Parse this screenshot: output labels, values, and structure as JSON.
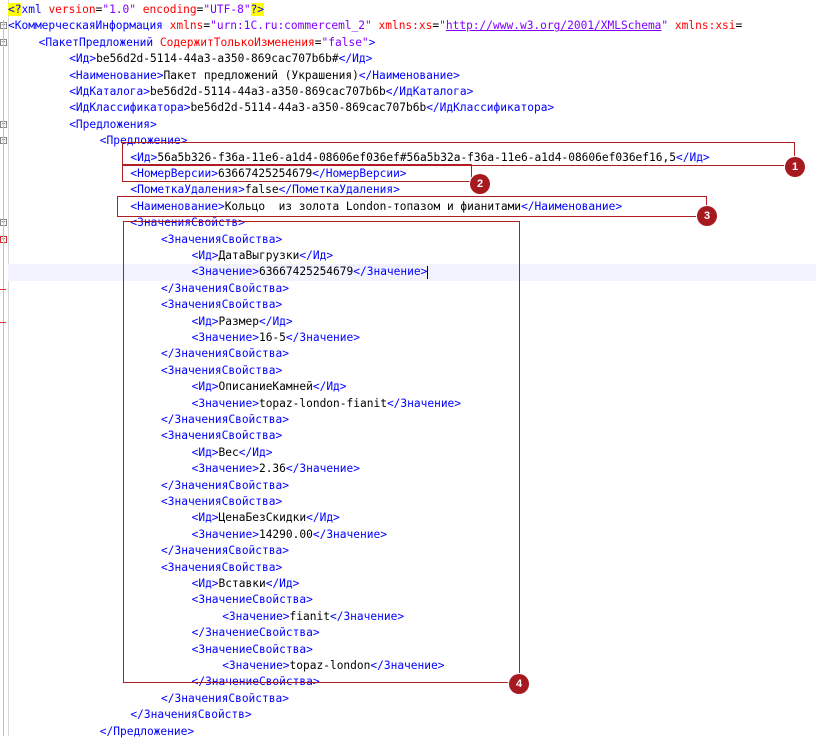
{
  "editor": {
    "lines": [
      {
        "indent": 0,
        "parts": [
          [
            "pi",
            "<?"
          ],
          [
            "t",
            "xml"
          ],
          [
            "a",
            " version"
          ],
          [
            "x",
            "="
          ],
          [
            "v",
            "\"1.0\""
          ],
          [
            "a",
            " encoding"
          ],
          [
            "x",
            "="
          ],
          [
            "v",
            "\"UTF-8\""
          ],
          [
            "pi",
            "?>"
          ]
        ]
      },
      {
        "indent": 0,
        "parts": [
          [
            "t",
            "<КоммерческаяИнформация"
          ],
          [
            "a",
            " xmlns"
          ],
          [
            "x",
            "="
          ],
          [
            "v",
            "\"urn:1C.ru:commerceml_2\""
          ],
          [
            "a",
            " xmlns:xs"
          ],
          [
            "x",
            "="
          ],
          [
            "v",
            "\""
          ],
          [
            "lnk",
            "http://www.w3.org/2001/XMLSchema"
          ],
          [
            "v",
            "\""
          ],
          [
            "a",
            " xmlns:xsi"
          ],
          [
            "x",
            "="
          ]
        ]
      },
      {
        "indent": 1,
        "parts": [
          [
            "t",
            "<ПакетПредложений"
          ],
          [
            "a",
            " СодержитТолькоИзменения"
          ],
          [
            "x",
            "="
          ],
          [
            "v",
            "\"false\""
          ],
          [
            "t",
            ">"
          ]
        ]
      },
      {
        "indent": 2,
        "parts": [
          [
            "t",
            "<Ид>"
          ],
          [
            "x",
            "be56d2d-5114-44a3-a350-869cac707b6b#"
          ],
          [
            "t",
            "</Ид>"
          ]
        ]
      },
      {
        "indent": 2,
        "parts": [
          [
            "t",
            "<Наименование>"
          ],
          [
            "x",
            "Пакет предложений (Украшения)"
          ],
          [
            "t",
            "</Наименование>"
          ]
        ]
      },
      {
        "indent": 2,
        "parts": [
          [
            "t",
            "<ИдКаталога>"
          ],
          [
            "x",
            "be56d2d-5114-44a3-a350-869cac707b6b"
          ],
          [
            "t",
            "</ИдКаталога>"
          ]
        ]
      },
      {
        "indent": 2,
        "parts": [
          [
            "t",
            "<ИдКлассификатора>"
          ],
          [
            "x",
            "be56d2d-5114-44a3-a350-869cac707b6b"
          ],
          [
            "t",
            "</ИдКлассификатора>"
          ]
        ]
      },
      {
        "indent": 2,
        "parts": [
          [
            "t",
            "<Предложения>"
          ]
        ]
      },
      {
        "indent": 3,
        "parts": [
          [
            "t",
            "<Предложение>"
          ]
        ]
      },
      {
        "indent": 4,
        "parts": [
          [
            "t",
            "<Ид>"
          ],
          [
            "x",
            "56a5b326-f36a-11e6-a1d4-08606ef036ef#56a5b32a-f36a-11e6-a1d4-08606ef036ef16,5"
          ],
          [
            "t",
            "</Ид>"
          ]
        ]
      },
      {
        "indent": 4,
        "parts": [
          [
            "t",
            "<НомерВерсии>"
          ],
          [
            "x",
            "63667425254679"
          ],
          [
            "t",
            "</НомерВерсии>"
          ]
        ]
      },
      {
        "indent": 4,
        "parts": [
          [
            "t",
            "<ПометкаУдаления>"
          ],
          [
            "x",
            "false"
          ],
          [
            "t",
            "</ПометкаУдаления>"
          ]
        ]
      },
      {
        "indent": 4,
        "parts": [
          [
            "t",
            "<Наименование>"
          ],
          [
            "x",
            "Кольцо  из золота London-топазом и фианитами"
          ],
          [
            "t",
            "</Наименование>"
          ]
        ]
      },
      {
        "indent": 4,
        "parts": [
          [
            "t",
            "<ЗначенияСвойств>"
          ]
        ]
      },
      {
        "indent": 5,
        "parts": [
          [
            "t",
            "<ЗначенияСвойства>"
          ]
        ]
      },
      {
        "indent": 6,
        "parts": [
          [
            "t",
            "<Ид>"
          ],
          [
            "x",
            "ДатаВыгрузки"
          ],
          [
            "t",
            "</Ид>"
          ]
        ]
      },
      {
        "indent": 6,
        "current": true,
        "parts": [
          [
            "t",
            "<Значение>"
          ],
          [
            "x",
            "63667425254679"
          ],
          [
            "t",
            "</Значение>"
          ]
        ]
      },
      {
        "indent": 5,
        "parts": [
          [
            "t",
            "</ЗначенияСвойства>"
          ]
        ]
      },
      {
        "indent": 5,
        "parts": [
          [
            "t",
            "<ЗначенияСвойства>"
          ]
        ]
      },
      {
        "indent": 6,
        "parts": [
          [
            "t",
            "<Ид>"
          ],
          [
            "x",
            "Размер"
          ],
          [
            "t",
            "</Ид>"
          ]
        ]
      },
      {
        "indent": 6,
        "parts": [
          [
            "t",
            "<Значение>"
          ],
          [
            "x",
            "16-5"
          ],
          [
            "t",
            "</Значение>"
          ]
        ]
      },
      {
        "indent": 5,
        "parts": [
          [
            "t",
            "</ЗначенияСвойства>"
          ]
        ]
      },
      {
        "indent": 5,
        "parts": [
          [
            "t",
            "<ЗначенияСвойства>"
          ]
        ]
      },
      {
        "indent": 6,
        "parts": [
          [
            "t",
            "<Ид>"
          ],
          [
            "x",
            "ОписаниеКамней"
          ],
          [
            "t",
            "</Ид>"
          ]
        ]
      },
      {
        "indent": 6,
        "parts": [
          [
            "t",
            "<Значение>"
          ],
          [
            "x",
            "topaz-london-fianit"
          ],
          [
            "t",
            "</Значение>"
          ]
        ]
      },
      {
        "indent": 5,
        "parts": [
          [
            "t",
            "</ЗначенияСвойства>"
          ]
        ]
      },
      {
        "indent": 5,
        "parts": [
          [
            "t",
            "<ЗначенияСвойства>"
          ]
        ]
      },
      {
        "indent": 6,
        "parts": [
          [
            "t",
            "<Ид>"
          ],
          [
            "x",
            "Вес"
          ],
          [
            "t",
            "</Ид>"
          ]
        ]
      },
      {
        "indent": 6,
        "parts": [
          [
            "t",
            "<Значение>"
          ],
          [
            "x",
            "2.36"
          ],
          [
            "t",
            "</Значение>"
          ]
        ]
      },
      {
        "indent": 5,
        "parts": [
          [
            "t",
            "</ЗначенияСвойства>"
          ]
        ]
      },
      {
        "indent": 5,
        "parts": [
          [
            "t",
            "<ЗначенияСвойства>"
          ]
        ]
      },
      {
        "indent": 6,
        "parts": [
          [
            "t",
            "<Ид>"
          ],
          [
            "x",
            "ЦенаБезСкидки"
          ],
          [
            "t",
            "</Ид>"
          ]
        ]
      },
      {
        "indent": 6,
        "parts": [
          [
            "t",
            "<Значение>"
          ],
          [
            "x",
            "14290.00"
          ],
          [
            "t",
            "</Значение>"
          ]
        ]
      },
      {
        "indent": 5,
        "parts": [
          [
            "t",
            "</ЗначенияСвойства>"
          ]
        ]
      },
      {
        "indent": 5,
        "parts": [
          [
            "t",
            "<ЗначенияСвойства>"
          ]
        ]
      },
      {
        "indent": 6,
        "parts": [
          [
            "t",
            "<Ид>"
          ],
          [
            "x",
            "Вставки"
          ],
          [
            "t",
            "</Ид>"
          ]
        ]
      },
      {
        "indent": 6,
        "parts": [
          [
            "t",
            "<ЗначениеСвойства>"
          ]
        ]
      },
      {
        "indent": 7,
        "parts": [
          [
            "t",
            "<Значение>"
          ],
          [
            "x",
            "fianit"
          ],
          [
            "t",
            "</Значение>"
          ]
        ]
      },
      {
        "indent": 6,
        "parts": [
          [
            "t",
            "</ЗначениеСвойства>"
          ]
        ]
      },
      {
        "indent": 6,
        "parts": [
          [
            "t",
            "<ЗначениеСвойства>"
          ]
        ]
      },
      {
        "indent": 7,
        "parts": [
          [
            "t",
            "<Значение>"
          ],
          [
            "x",
            "topaz-london"
          ],
          [
            "t",
            "</Значение>"
          ]
        ]
      },
      {
        "indent": 6,
        "parts": [
          [
            "t",
            "</ЗначениеСвойства>"
          ]
        ]
      },
      {
        "indent": 5,
        "parts": [
          [
            "t",
            "</ЗначенияСвойства>"
          ]
        ]
      },
      {
        "indent": 4,
        "parts": [
          [
            "t",
            "</ЗначенияСвойств>"
          ]
        ]
      },
      {
        "indent": 3,
        "parts": [
          [
            "t",
            "</Предложение>"
          ]
        ]
      }
    ]
  },
  "annotations": [
    {
      "label": "1"
    },
    {
      "label": "2"
    },
    {
      "label": "3"
    },
    {
      "label": "4"
    }
  ],
  "colors": {
    "tag": "#0000ff",
    "attribute": "#ff0000",
    "attr_value": "#8000ff",
    "pi_highlight": "#ffff00",
    "annotation": "#b01e24",
    "badge": "#a6191f"
  }
}
